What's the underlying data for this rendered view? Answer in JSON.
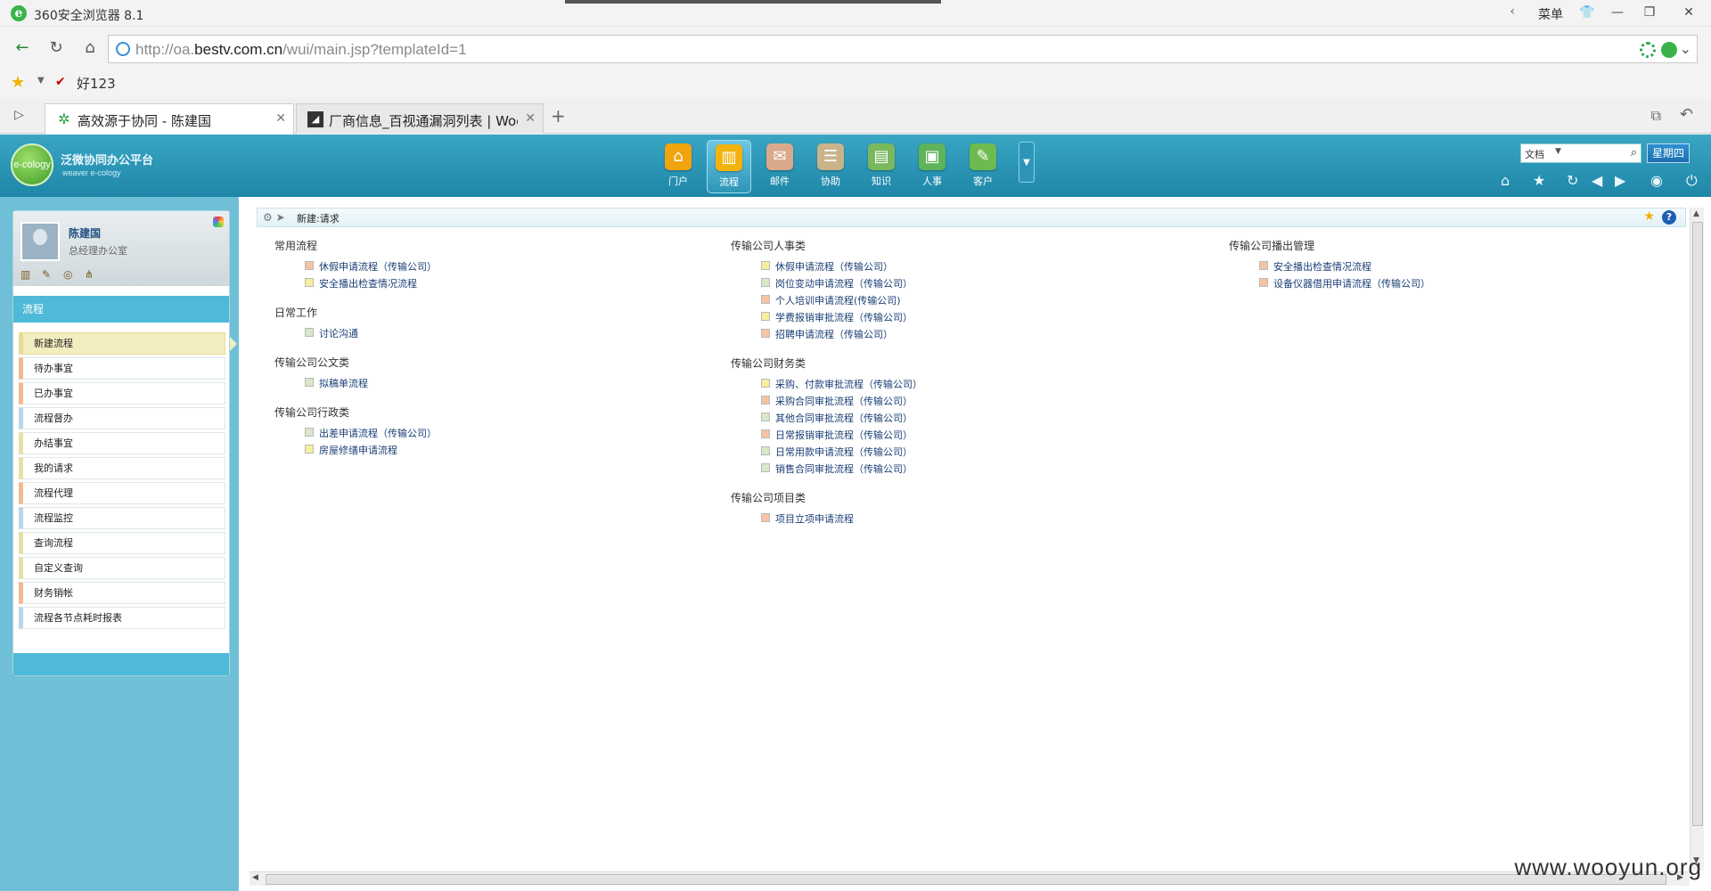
{
  "browser": {
    "title": "360安全浏览器 8.1",
    "menu_label": "菜单",
    "url_prefix": "http://oa.",
    "url_domain": "bestv.com.cn",
    "url_path": "/wui/main.jsp?templateId=1",
    "fav_label": "好123",
    "tabs": [
      {
        "label": "高效源于协同 - 陈建国",
        "icon": "gear-icon"
      },
      {
        "label": "厂商信息_百视通漏洞列表 | Woo",
        "icon": "page-icon"
      }
    ]
  },
  "app": {
    "brand": "泛微协同办公平台",
    "brand_sub": "weaver e-cology",
    "logo_text": "e-cology",
    "modules": [
      {
        "label": "门户",
        "icon": "home-icon",
        "color": "#f2a40f"
      },
      {
        "label": "流程",
        "icon": "chart-icon",
        "color": "#f2b30f"
      },
      {
        "label": "邮件",
        "icon": "mail-icon",
        "color": "#d9a98c"
      },
      {
        "label": "协助",
        "icon": "clipboard-icon",
        "color": "#c9b38a"
      },
      {
        "label": "知识",
        "icon": "book-icon",
        "color": "#7ab85e"
      },
      {
        "label": "人事",
        "icon": "id-card-icon",
        "color": "#5fb35a"
      },
      {
        "label": "客户",
        "icon": "person-icon",
        "color": "#6dbb4e"
      }
    ],
    "search_select": "文档",
    "weekday": "星期四"
  },
  "user": {
    "name": "陈建国",
    "title": "总经理办公室"
  },
  "sidebar": {
    "section": "流程",
    "items": [
      {
        "label": "新建流程",
        "color": "#e8dc90"
      },
      {
        "label": "待办事宜",
        "color": "#f5b98d"
      },
      {
        "label": "已办事宜",
        "color": "#f5b98d"
      },
      {
        "label": "流程督办",
        "color": "#b9d6ea"
      },
      {
        "label": "办结事宜",
        "color": "#e8e0a0"
      },
      {
        "label": "我的请求",
        "color": "#e8e0a0"
      },
      {
        "label": "流程代理",
        "color": "#f5b98d"
      },
      {
        "label": "流程监控",
        "color": "#b9d6ea"
      },
      {
        "label": "查询流程",
        "color": "#e8e0a0"
      },
      {
        "label": "自定义查询",
        "color": "#e8e0a0"
      },
      {
        "label": "财务销帐",
        "color": "#f5b98d"
      },
      {
        "label": "流程各节点耗时报表",
        "color": "#b9d6ea"
      }
    ]
  },
  "main": {
    "title": "新建:请求",
    "columns": [
      {
        "groups": [
          {
            "name": "常用流程",
            "items": [
              {
                "label": "休假申请流程（传输公司）",
                "color": "#f6c4a4"
              },
              {
                "label": "安全播出检查情况流程",
                "color": "#f5ef9c"
              }
            ]
          },
          {
            "name": "日常工作",
            "items": [
              {
                "label": "讨论沟通",
                "color": "#d9e8c8"
              }
            ]
          },
          {
            "name": "传输公司公文类",
            "items": [
              {
                "label": "拟稿单流程",
                "color": "#d9e8c8"
              }
            ]
          },
          {
            "name": "传输公司行政类",
            "items": [
              {
                "label": "出差申请流程（传输公司）",
                "color": "#d9e8c8"
              },
              {
                "label": "房屋修缮申请流程",
                "color": "#f5ef9c"
              }
            ]
          }
        ]
      },
      {
        "groups": [
          {
            "name": "传输公司人事类",
            "items": [
              {
                "label": "休假申请流程（传输公司）",
                "color": "#f5ef9c"
              },
              {
                "label": "岗位变动申请流程（传输公司）",
                "color": "#d9e8c8"
              },
              {
                "label": "个人培训申请流程(传输公司)",
                "color": "#f6c4a4"
              },
              {
                "label": "学费报销审批流程（传输公司）",
                "color": "#f5ef9c"
              },
              {
                "label": "招聘申请流程（传输公司）",
                "color": "#f6c4a4"
              }
            ]
          },
          {
            "name": "传输公司财务类",
            "items": [
              {
                "label": "采购、付款审批流程（传输公司）",
                "color": "#f5ef9c"
              },
              {
                "label": "采购合同审批流程（传输公司）",
                "color": "#f6c4a4"
              },
              {
                "label": "其他合同审批流程（传输公司）",
                "color": "#d9e8c8"
              },
              {
                "label": "日常报销审批流程（传输公司）",
                "color": "#f6c4a4"
              },
              {
                "label": "日常用款申请流程（传输公司）",
                "color": "#d9e8c8"
              },
              {
                "label": "销售合同审批流程（传输公司）",
                "color": "#d9e8c8"
              }
            ]
          },
          {
            "name": "传输公司项目类",
            "items": [
              {
                "label": "项目立项申请流程",
                "color": "#f6c4a4"
              }
            ]
          }
        ]
      },
      {
        "groups": [
          {
            "name": "传输公司播出管理",
            "items": [
              {
                "label": "安全播出检查情况流程",
                "color": "#f6c4a4"
              },
              {
                "label": "设备仪器借用申请流程（传输公司）",
                "color": "#f6c4a4"
              }
            ]
          }
        ]
      }
    ]
  },
  "watermark": "www.wooyun.org"
}
